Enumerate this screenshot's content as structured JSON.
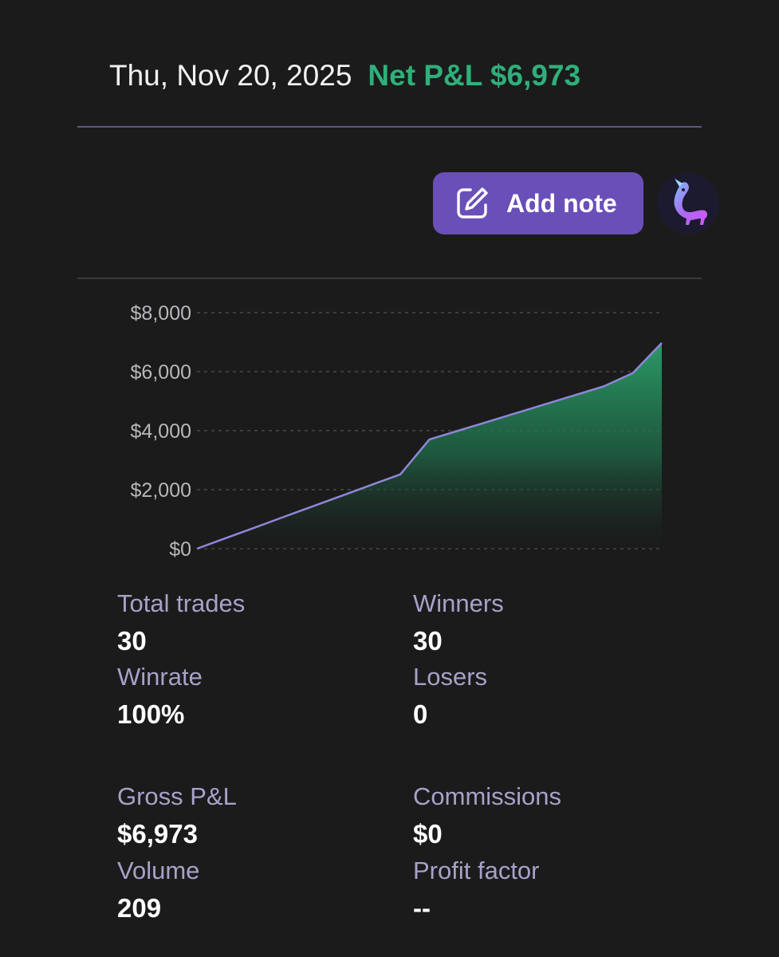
{
  "header": {
    "date": "Thu, Nov 20, 2025",
    "net_pnl": "Net P&L $6,973"
  },
  "actions": {
    "add_note_label": "Add note",
    "add_note_icon": "edit-note-icon",
    "avatar_icon": "unicorn-avatar-icon"
  },
  "colors": {
    "background": "#1b1b1c",
    "profit_green": "#2eb07a",
    "accent_purple": "#6a4fb8",
    "line_purple": "#8f86d8",
    "label_lavender": "#a6a2c8"
  },
  "chart_data": {
    "type": "area",
    "x": [
      0,
      1,
      2,
      3,
      4,
      5,
      6,
      7,
      8,
      9,
      10,
      11,
      12,
      13,
      14,
      15,
      16
    ],
    "values": [
      0,
      360,
      720,
      1080,
      1440,
      1800,
      2160,
      2520,
      3700,
      4000,
      4300,
      4600,
      4900,
      5200,
      5500,
      5950,
      6973
    ],
    "yticks": [
      "$8,000",
      "$6,000",
      "$4,000",
      "$2,000",
      "$0"
    ],
    "ytick_values": [
      8000,
      6000,
      4000,
      2000,
      0
    ],
    "ylim": [
      0,
      8000
    ],
    "grid": true,
    "title": "",
    "xlabel": "",
    "ylabel": ""
  },
  "stats": {
    "total_trades_label": "Total trades",
    "total_trades_value": "30",
    "winners_label": "Winners",
    "winners_value": "30",
    "winrate_label": "Winrate",
    "winrate_value": "100%",
    "losers_label": "Losers",
    "losers_value": "0",
    "gross_pnl_label": "Gross P&L",
    "gross_pnl_value": "$6,973",
    "commissions_label": "Commissions",
    "commissions_value": "$0",
    "volume_label": "Volume",
    "volume_value": "209",
    "profit_factor_label": "Profit factor",
    "profit_factor_value": "--"
  }
}
